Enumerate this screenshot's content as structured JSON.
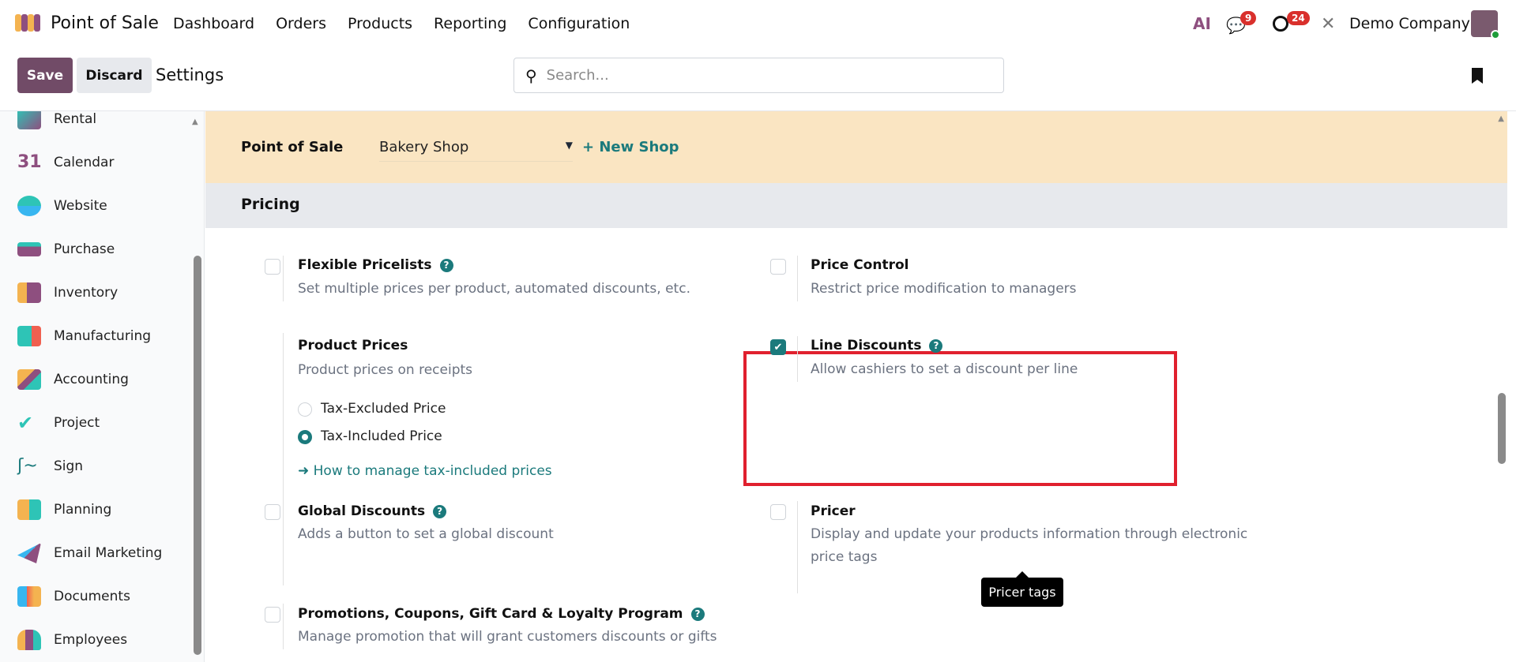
{
  "app": {
    "title": "Point of Sale",
    "menu": [
      "Dashboard",
      "Orders",
      "Products",
      "Reporting",
      "Configuration"
    ]
  },
  "systray": {
    "ai_label": "AI",
    "messages_count": "9",
    "activities_count": "24",
    "company": "Demo Company"
  },
  "control": {
    "save": "Save",
    "discard": "Discard",
    "title": "Settings",
    "search_placeholder": "Search..."
  },
  "sidebar": {
    "items": [
      "Rental",
      "Calendar",
      "Website",
      "Purchase",
      "Inventory",
      "Manufacturing",
      "Accounting",
      "Project",
      "Sign",
      "Planning",
      "Email Marketing",
      "Documents",
      "Employees"
    ]
  },
  "banner": {
    "label": "Point of Sale",
    "shop": "Bakery Shop",
    "new_shop": "+ New Shop"
  },
  "section": {
    "title": "Pricing"
  },
  "settings": {
    "flexible": {
      "title": "Flexible Pricelists",
      "desc": "Set multiple prices per product, automated discounts, etc.",
      "checked": false
    },
    "price_control": {
      "title": "Price Control",
      "desc": "Restrict price modification to managers",
      "checked": false
    },
    "product_prices": {
      "title": "Product Prices",
      "desc": "Product prices on receipts",
      "options": [
        "Tax-Excluded Price",
        "Tax-Included Price"
      ],
      "selected": "Tax-Included Price",
      "link": "➜ How to manage tax-included prices"
    },
    "line_discounts": {
      "title": "Line Discounts",
      "desc": "Allow cashiers to set a discount per line",
      "checked": true
    },
    "global_discounts": {
      "title": "Global Discounts",
      "desc": "Adds a button to set a global discount",
      "checked": false
    },
    "pricer": {
      "title": "Pricer",
      "desc1": "Display and update your products information through electronic",
      "desc2": "price tags",
      "checked": false
    },
    "promotions": {
      "title": "Promotions, Coupons, Gift Card & Loyalty Program",
      "desc": "Manage promotion that will grant customers discounts or gifts",
      "checked": false
    }
  },
  "tooltip": {
    "text": "Pricer tags"
  },
  "colors": {
    "brand": "#714b67",
    "accent": "#1b7a7c",
    "highlight": "#e0202e",
    "banner": "#fae5c2"
  }
}
